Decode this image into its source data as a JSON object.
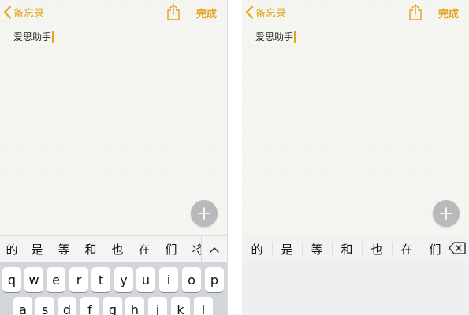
{
  "left": {
    "nav": {
      "back_label": "备忘录",
      "done_label": "完成"
    },
    "note_text": "爱思助手",
    "candidates": [
      "的",
      "是",
      "等",
      "和",
      "也",
      "在",
      "们",
      "将"
    ],
    "keyboard": {
      "row1": [
        "q",
        "w",
        "e",
        "r",
        "t",
        "y",
        "u",
        "i",
        "o",
        "p"
      ],
      "row2": [
        "a",
        "s",
        "d",
        "f",
        "g",
        "h",
        "j",
        "k",
        "l"
      ]
    }
  },
  "right": {
    "nav": {
      "back_label": "备忘录",
      "done_label": "完成"
    },
    "note_text": "爱思助手",
    "candidates": [
      "的",
      "是",
      "等",
      "和",
      "也",
      "在",
      "们"
    ]
  },
  "icons": {
    "back": "chevron-left-icon",
    "share": "share-icon",
    "add": "plus-icon",
    "expand": "chevron-up-icon",
    "delete": "delete-backspace-icon"
  },
  "colors": {
    "accent": "#e3a31b",
    "fab": "#b8b9bb",
    "keyboard_bg": "#d2d5db"
  }
}
